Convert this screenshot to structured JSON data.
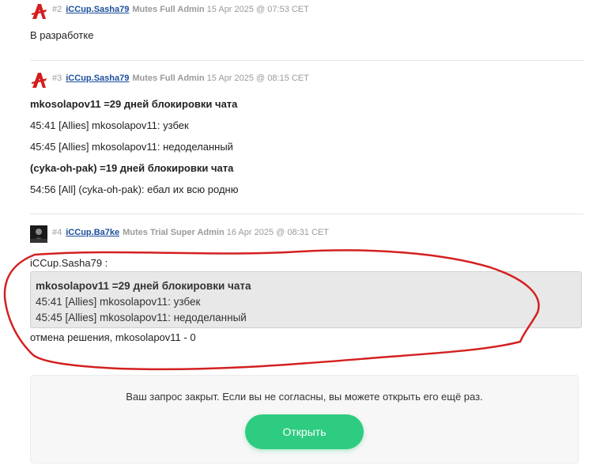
{
  "posts": [
    {
      "num": "#2",
      "author": "iCCup.Sasha79",
      "section": "Mutes",
      "role": "Full Admin",
      "date": "15 Apr 2025 @ 07:53 CET",
      "avatar_icon": "red-a-logo-icon",
      "lines": [
        "В разработке"
      ]
    },
    {
      "num": "#3",
      "author": "iCCup.Sasha79",
      "section": "Mutes",
      "role": "Full Admin",
      "date": "15 Apr 2025 @ 08:15 CET",
      "avatar_icon": "red-a-logo-icon",
      "lines": [
        "mkosolapov11 =29 дней блокировки чата",
        "45:41 [Allies] mkosolapov11: узбек",
        "45:45 [Allies] mkosolapov11: недоделанный",
        "(cyka-oh-pak) =19 дней блокировки чата",
        "54:56 [All] (cyka-oh-pak): ебал их всю родню"
      ]
    },
    {
      "num": "#4",
      "author": "iCCup.Ba7ke",
      "section": "Mutes",
      "role": "Trial Super Admin",
      "date": "16 Apr 2025 @ 08:31 CET",
      "avatar_icon": "dark-avatar-icon",
      "quote_author": "iCCup.Sasha79 :",
      "quote_lines": [
        "mkosolapov11 =29 дней блокировки чата",
        "45:41 [Allies] mkosolapov11: узбек",
        "45:45 [Allies] mkosolapov11: недоделанный"
      ],
      "after_quote": "отмена решения, mkosolapov11 - 0"
    }
  ],
  "notice": {
    "text": "Ваш запрос закрыт. Если вы не согласны, вы можете открыть его ещё раз.",
    "button_label": "Открыть",
    "button_color": "#2ecc80"
  },
  "annotation_color": "#d42020"
}
